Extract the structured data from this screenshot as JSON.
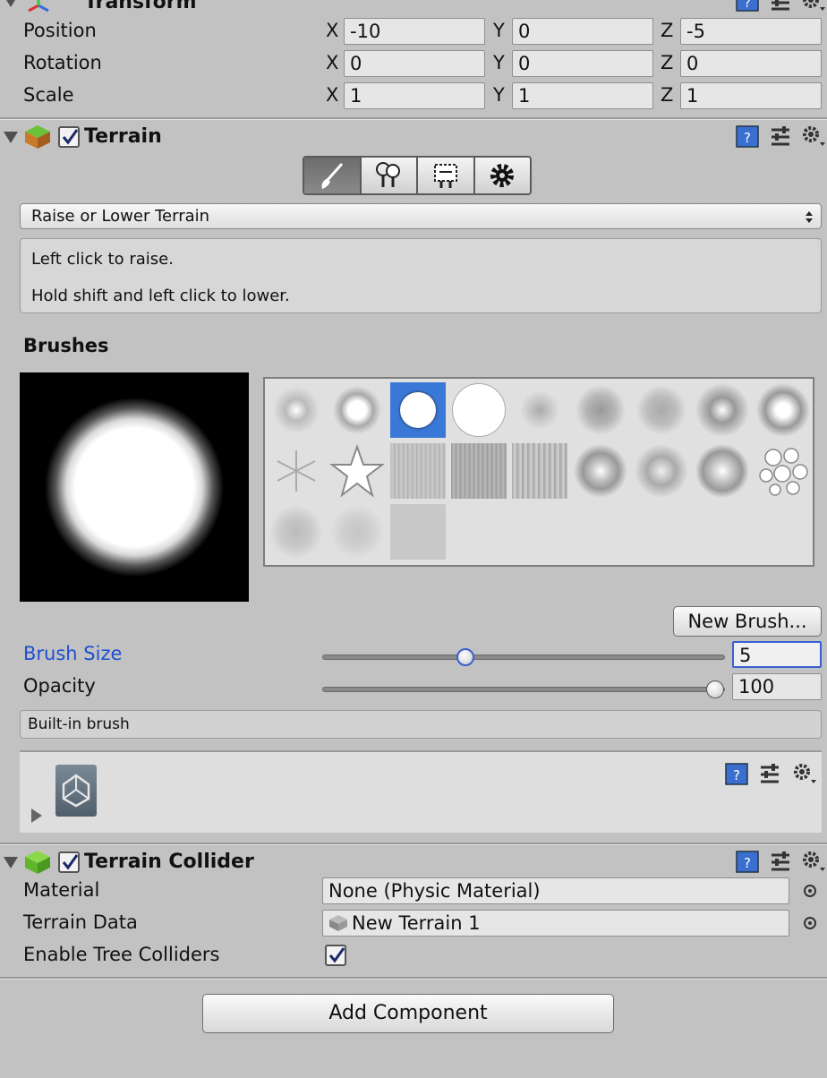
{
  "transform": {
    "title": "Transform",
    "rows": [
      {
        "label": "Position",
        "x": "-10",
        "y": "0",
        "z": "-5"
      },
      {
        "label": "Rotation",
        "x": "0",
        "y": "0",
        "z": "0"
      },
      {
        "label": "Scale",
        "x": "1",
        "y": "1",
        "z": "1"
      }
    ],
    "axis_x": "X",
    "axis_y": "Y",
    "axis_z": "Z"
  },
  "terrain": {
    "title": "Terrain",
    "enabled": true,
    "tools": [
      "paintbrush-icon",
      "tree-icon",
      "detail-icon",
      "settings-icon"
    ],
    "active_tool": 0,
    "mode_dropdown": "Raise or Lower Terrain",
    "help_line1": "Left click to raise.",
    "help_line2": "Hold shift and left click to lower.",
    "brushes_heading": "Brushes",
    "selected_brush": 2,
    "new_brush_label": "New Brush...",
    "brush_size_label": "Brush Size",
    "brush_size_value": "5",
    "brush_size_fraction": 0.36,
    "opacity_label": "Opacity",
    "opacity_value": "100",
    "opacity_fraction": 1.0,
    "brush_info": "Built-in brush"
  },
  "terrain_collider": {
    "title": "Terrain Collider",
    "enabled": true,
    "material_label": "Material",
    "material_value": "None (Physic Material)",
    "terrain_data_label": "Terrain Data",
    "terrain_data_value": "New Terrain 1",
    "tree_colliders_label": "Enable Tree Colliders",
    "tree_colliders": true
  },
  "add_component_label": "Add Component",
  "colors": {
    "background": "#c2c2c2",
    "brush_size_label": "#1f4fd0",
    "selected_brush": "#3a78d8",
    "focused_field_border": "#3a5fd0"
  }
}
